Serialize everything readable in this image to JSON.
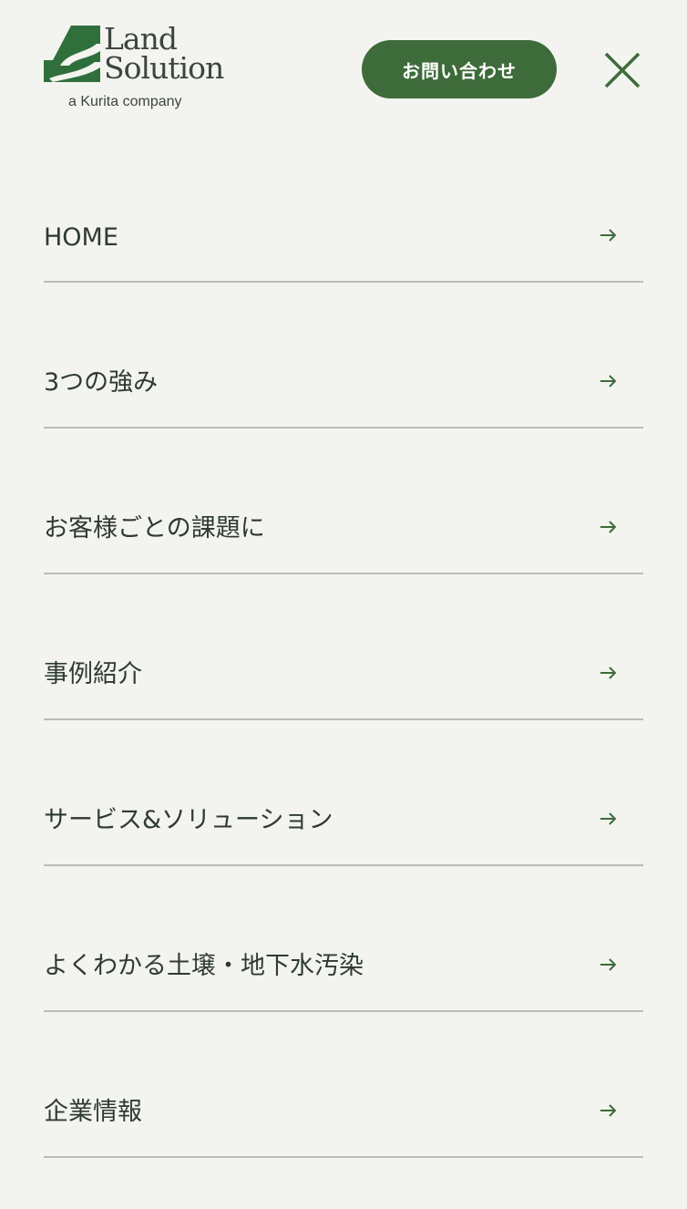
{
  "header": {
    "logo": {
      "line1": "Land",
      "line2": "Solution",
      "tagline": "a Kurita company"
    },
    "contact_label": "お問い合わせ",
    "close_icon": "close-icon"
  },
  "menu": {
    "items": [
      {
        "label": "HOME",
        "icon": "arrow-right-icon"
      },
      {
        "label": "3つの強み",
        "icon": "arrow-right-icon"
      },
      {
        "label": "お客様ごとの課題に",
        "icon": "arrow-right-icon"
      },
      {
        "label": "事例紹介",
        "icon": "arrow-right-icon"
      },
      {
        "label": "サービス&ソリューション",
        "icon": "arrow-right-icon"
      },
      {
        "label": "よくわかる土壌・地下水汚染",
        "icon": "arrow-right-icon"
      },
      {
        "label": "企業情報",
        "icon": "arrow-right-icon"
      }
    ]
  },
  "colors": {
    "background": "#f3f4ef",
    "brand_green": "#3e6b3a",
    "text": "#2f3a33",
    "divider": "#b9bdb6"
  }
}
